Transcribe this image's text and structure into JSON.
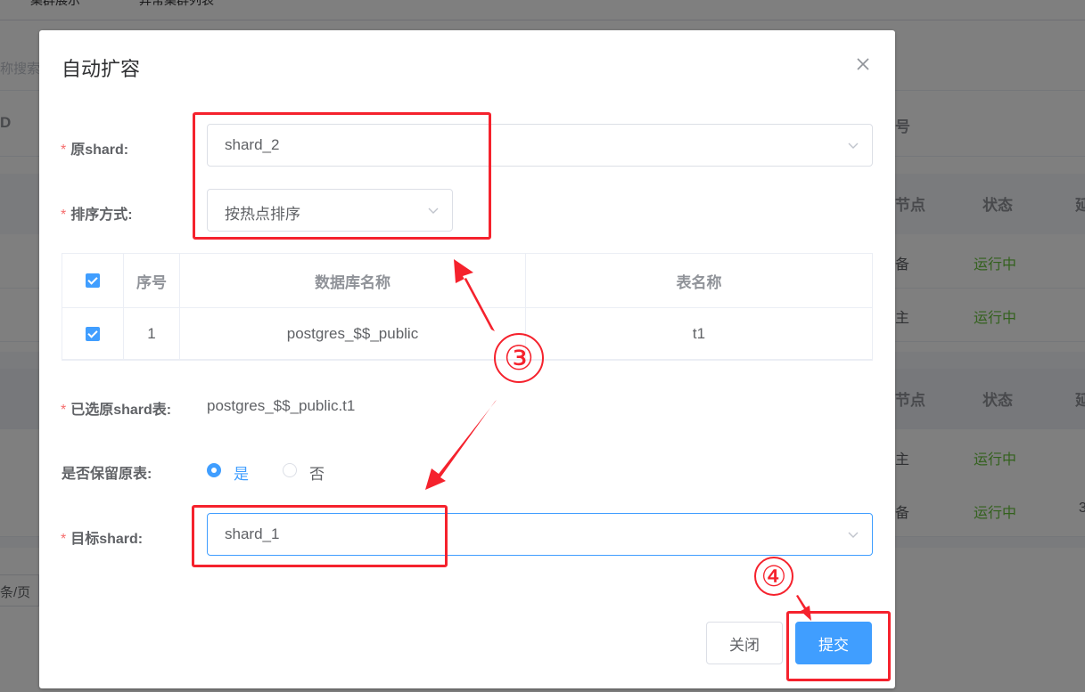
{
  "background": {
    "tabs": [
      "集群展示",
      "异常集群列表"
    ],
    "search_fragment": "称搜索",
    "header_fragment_left": "D",
    "header_fragment_right": "号",
    "table1": {
      "col_node": "节点",
      "col_status": "状态",
      "col_more": "延"
    },
    "rows": [
      {
        "left": "备",
        "status": "运行中"
      },
      {
        "left": "主",
        "status": "运行中"
      },
      {
        "left": "主",
        "status": "运行中"
      },
      {
        "left": "备",
        "status": "运行中",
        "extra": "3"
      }
    ],
    "pagination_fragment": "条/页"
  },
  "dialog": {
    "title": "自动扩容",
    "fields": {
      "source_shard": {
        "label": "原shard:",
        "value": "shard_2"
      },
      "sort_method": {
        "label": "排序方式:",
        "value": "按热点排序"
      },
      "selected_tables": {
        "label": "已选原shard表:",
        "value": "postgres_$$_public.t1"
      },
      "keep_source": {
        "label": "是否保留原表:",
        "options": [
          "是",
          "否"
        ],
        "selected": "是"
      },
      "target_shard": {
        "label": "目标shard:",
        "value": "shard_1"
      }
    },
    "table": {
      "headers": [
        "序号",
        "数据库名称",
        "表名称"
      ],
      "rows": [
        {
          "index": "1",
          "database": "postgres_$$_public",
          "table": "t1"
        }
      ]
    },
    "buttons": {
      "close": "关闭",
      "submit": "提交"
    }
  },
  "annotations": {
    "step3": "③",
    "step4": "④"
  },
  "colors": {
    "primary": "#409eff",
    "annotation": "#f5222d",
    "success": "#67c23a",
    "required": "#f56c6c"
  }
}
